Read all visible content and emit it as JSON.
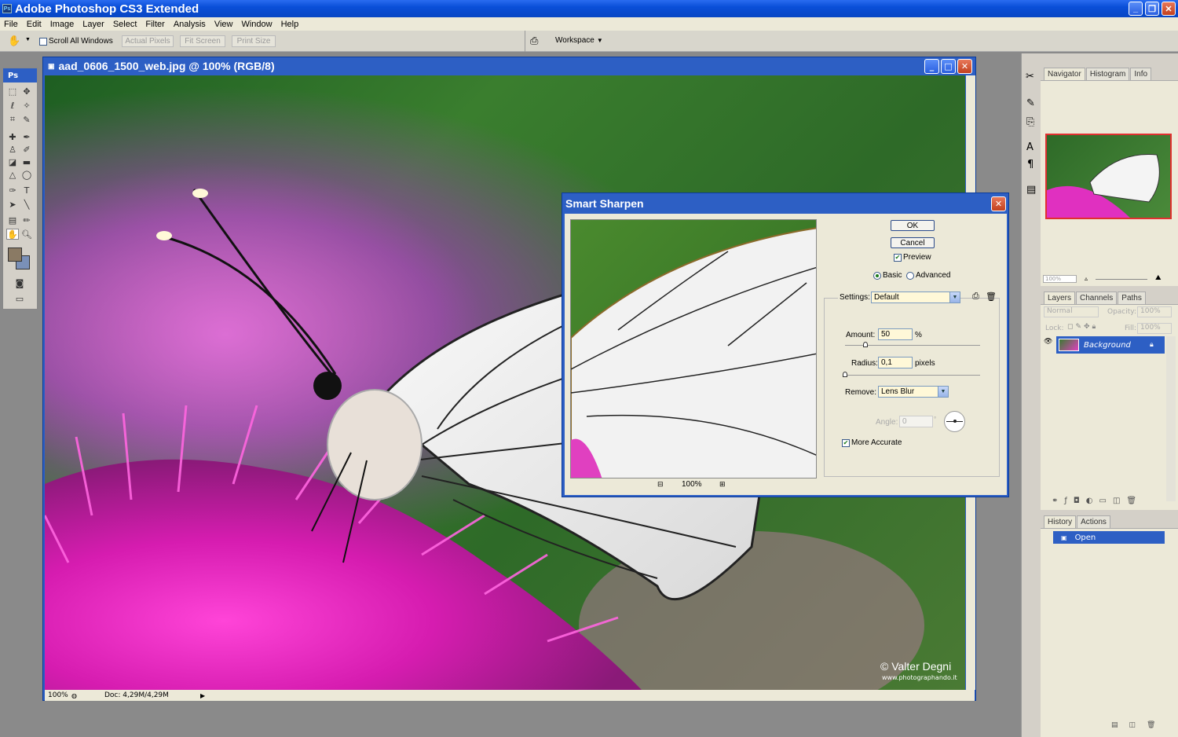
{
  "app": {
    "title": "Adobe Photoshop CS3 Extended"
  },
  "menu": [
    "File",
    "Edit",
    "Image",
    "Layer",
    "Select",
    "Filter",
    "Analysis",
    "View",
    "Window",
    "Help"
  ],
  "options": {
    "scroll_all": "Scroll All Windows",
    "actual_pixels": "Actual Pixels",
    "fit_screen": "Fit Screen",
    "print_size": "Print Size",
    "workspace": "Workspace"
  },
  "tools": {
    "header": "Ps"
  },
  "document": {
    "title": "aad_0606_1500_web.jpg @ 100% (RGB/8)",
    "zoom": "100%",
    "doc_size": "Doc: 4,29M/4,29M",
    "credit": "© Valter Degni",
    "credit_url": "www.photographando.it"
  },
  "navigator": {
    "tabs": [
      "Navigator",
      "Histogram",
      "Info"
    ],
    "zoom": "100%"
  },
  "layers": {
    "tabs": [
      "Layers",
      "Channels",
      "Paths"
    ],
    "blend_mode": "Normal",
    "opacity_label": "Opacity:",
    "opacity": "100%",
    "lock_label": "Lock:",
    "fill_label": "Fill:",
    "fill": "100%",
    "layer_name": "Background"
  },
  "history": {
    "tabs": [
      "History",
      "Actions"
    ],
    "item": "Open"
  },
  "dialog": {
    "title": "Smart Sharpen",
    "ok": "OK",
    "cancel": "Cancel",
    "preview": "Preview",
    "basic": "Basic",
    "advanced": "Advanced",
    "settings_label": "Settings:",
    "settings_value": "Default",
    "amount_label": "Amount:",
    "amount_value": "50",
    "amount_unit": "%",
    "amount_slider": 0.15,
    "radius_label": "Radius:",
    "radius_value": "0,1",
    "radius_unit": "pixels",
    "radius_slider": 0.0,
    "remove_label": "Remove:",
    "remove_value": "Lens Blur",
    "angle_label": "Angle:",
    "angle_value": "0",
    "more_accurate": "More Accurate",
    "preview_zoom": "100%"
  }
}
